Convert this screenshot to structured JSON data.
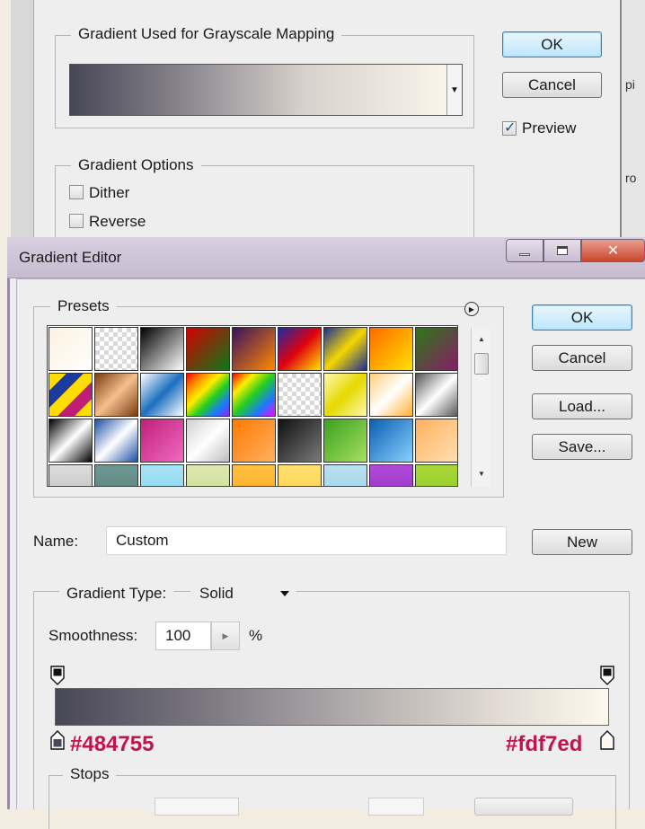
{
  "gradient_map": {
    "group_grayscale_label": "Gradient Used for Grayscale Mapping",
    "group_options_label": "Gradient Options",
    "dither_label": "Dither",
    "reverse_label": "Reverse",
    "ok_label": "OK",
    "cancel_label": "Cancel",
    "preview_label": "Preview",
    "preview_checked": true,
    "right_fragments": [
      "pi",
      "ro"
    ]
  },
  "gradient_editor": {
    "title": "Gradient Editor",
    "presets_label": "Presets",
    "buttons": {
      "ok": "OK",
      "cancel": "Cancel",
      "load": "Load...",
      "save": "Save...",
      "new": "New"
    },
    "name_label": "Name:",
    "name_value": "Custom",
    "gradient_type_label": "Gradient Type:",
    "gradient_type_value": "Solid",
    "smoothness_label": "Smoothness:",
    "smoothness_value": "100",
    "smoothness_unit": "%",
    "stops_label": "Stops",
    "start_color": "#484755",
    "end_color": "#fdf7ed",
    "annotation_color": "#c2124f",
    "preset_swatches": [
      "linear-gradient(135deg,#fbf1df,#ffffff)",
      "repeating-conic-gradient(#d8d8d8 0 25%,#ffffff 0 50%) 0 0/10px 10px",
      "linear-gradient(135deg,#000000,#ffffff)",
      "linear-gradient(135deg,#d40000,#0a7a18)",
      "linear-gradient(135deg,#3b1160,#ff8a00)",
      "linear-gradient(135deg,#1b2aa8,#e00010,#ffe600)",
      "linear-gradient(135deg,#1a2d9a,#f5d800,#1a2d9a)",
      "linear-gradient(135deg,#ff6a00,#ffe000)",
      "linear-gradient(135deg,#2b7a14,#8a1a6a)",
      "linear-gradient(135deg,#ffdd00 0 20%,#1a3aa0 20% 40%,#ffdd00 40% 60%,#c01c7a 60% 80%,#ffdd00 80%)",
      "linear-gradient(135deg,#7b3b12,#f4c08c,#7b3b12)",
      "linear-gradient(135deg,#ffffff,#1b6fc0,#ffffff)",
      "linear-gradient(135deg,#ff0000,#ff8a00,#ffee00,#22cc22,#1a7bff,#8a2be2)",
      "linear-gradient(135deg,#ff0000,#ffee00,#22cc22,#1a7bff,#ff00ff)",
      "repeating-conic-gradient(#d8d8d8 0 25%,#ffffff 0 50%) 0 0/10px 10px",
      "linear-gradient(135deg,#fff9b0,#e6d800,#fff9b0)",
      "linear-gradient(135deg,#ffcf7a,#ffffff,#ffb030)",
      "linear-gradient(135deg,#555555,#ffffff 50%,#555555)",
      "linear-gradient(135deg,#000000,#ffffff 50%,#000000)",
      "linear-gradient(135deg,#1d4fa8,#ffffff 50%,#1d4fa8)",
      "linear-gradient(135deg,#c0207a,#f06ac0)",
      "linear-gradient(135deg,#cfcfcf,#ffffff,#bdbdbd)",
      "linear-gradient(135deg,#ff7a00,#ffb060)",
      "linear-gradient(135deg,#111111,#7a7a7a)",
      "linear-gradient(135deg,#3aa01e,#a6e060)",
      "linear-gradient(135deg,#0a5fb0,#8ad0ff)",
      "linear-gradient(135deg,#ffb060,#ffe0b0)",
      "linear-gradient(#dddddd,#bbbbbb)",
      "linear-gradient(#6f9692,#557f7a)",
      "linear-gradient(#a8e4f4,#7fd0ee)",
      "linear-gradient(#dde8b0,#c9dc8c)",
      "linear-gradient(#ffc040,#ffa820)",
      "linear-gradient(#ffe070,#ffd040)",
      "linear-gradient(#b8e0f0,#9cd0e8)",
      "linear-gradient(#b04ad8,#9030c0)",
      "linear-gradient(#a8d838,#8cc820)"
    ]
  }
}
